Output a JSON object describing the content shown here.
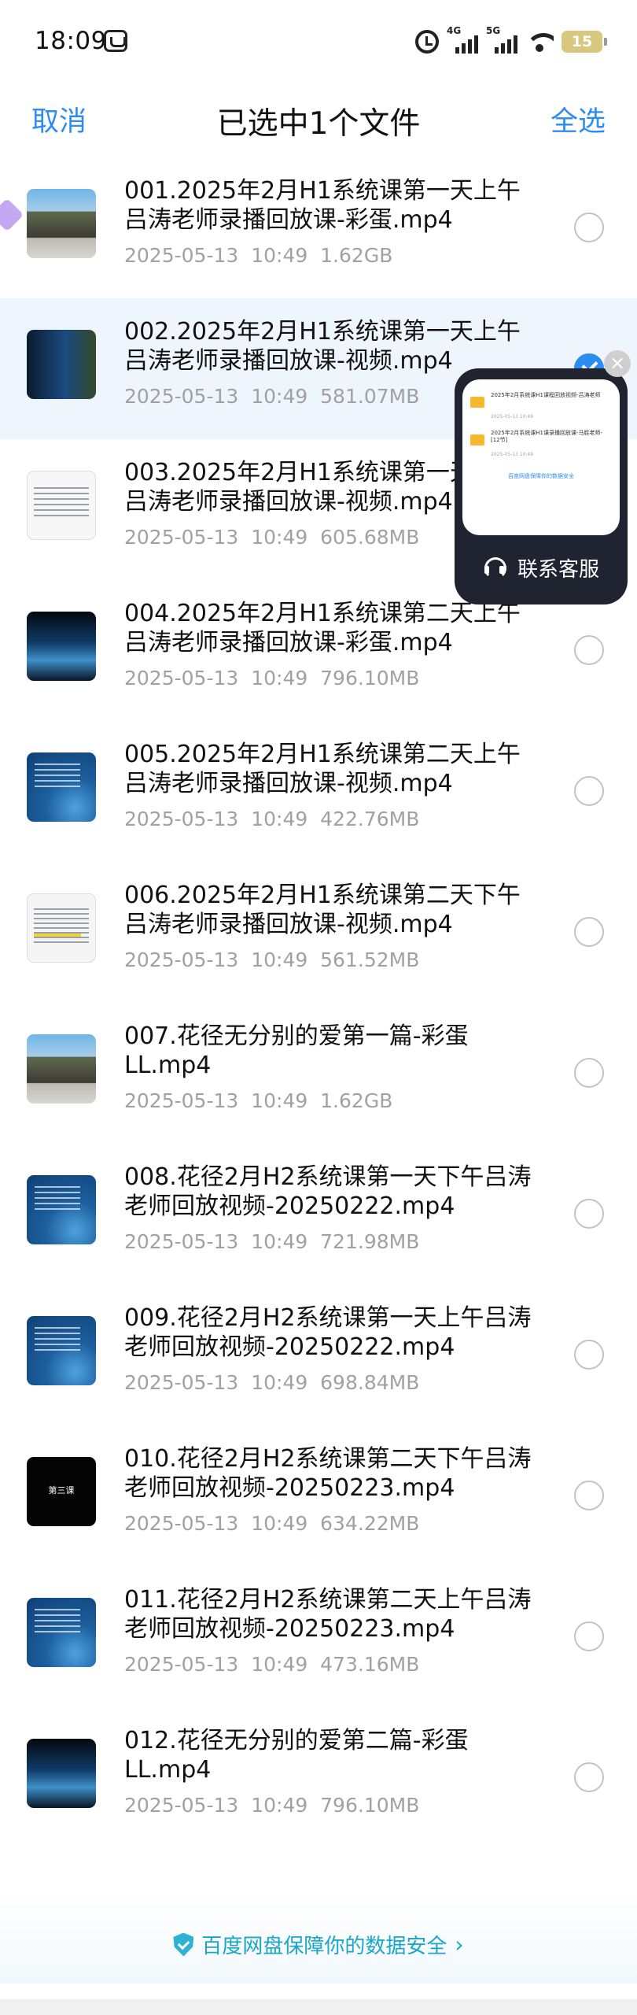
{
  "status_bar": {
    "time": "18:09",
    "network_1": "4G",
    "network_2": "5G",
    "battery": "15"
  },
  "header": {
    "cancel_label": "取消",
    "title": "已选中1个文件",
    "select_all_label": "全选"
  },
  "files": [
    {
      "name": "001.2025年2月H1系统课第一天上午吕涛老师录播回放课-彩蛋.mp4",
      "date": "2025-05-13",
      "time": "10:49",
      "size": "1.62GB",
      "thumb": "photo",
      "selected": false
    },
    {
      "name": "002.2025年2月H1系统课第一天上午吕涛老师录播回放课-视频.mp4",
      "date": "2025-05-13",
      "time": "10:49",
      "size": "581.07MB",
      "thumb": "dark",
      "selected": true
    },
    {
      "name": "003.2025年2月H1系统课第一天下午吕涛老师录播回放课-视频.mp4",
      "date": "2025-05-13",
      "time": "10:49",
      "size": "605.68MB",
      "thumb": "doc",
      "selected": false
    },
    {
      "name": "004.2025年2月H1系统课第二天上午吕涛老师录播回放课-彩蛋.mp4",
      "date": "2025-05-13",
      "time": "10:49",
      "size": "796.10MB",
      "thumb": "mountain",
      "selected": false
    },
    {
      "name": "005.2025年2月H1系统课第二天上午吕涛老师录播回放课-视频.mp4",
      "date": "2025-05-13",
      "time": "10:49",
      "size": "422.76MB",
      "thumb": "blue",
      "selected": false
    },
    {
      "name": "006.2025年2月H1系统课第二天下午吕涛老师录播回放课-视频.mp4",
      "date": "2025-05-13",
      "time": "10:49",
      "size": "561.52MB",
      "thumb": "doc-yellow",
      "selected": false
    },
    {
      "name": "007.花径无分别的爱第一篇-彩蛋LL.mp4",
      "date": "2025-05-13",
      "time": "10:49",
      "size": "1.62GB",
      "thumb": "photo",
      "selected": false
    },
    {
      "name": "008.花径2月H2系统课第一天下午吕涛老师回放视频-20250222.mp4",
      "date": "2025-05-13",
      "time": "10:49",
      "size": "721.98MB",
      "thumb": "blue",
      "selected": false
    },
    {
      "name": "009.花径2月H2系统课第一天上午吕涛老师回放视频-20250222.mp4",
      "date": "2025-05-13",
      "time": "10:49",
      "size": "698.84MB",
      "thumb": "blue",
      "selected": false
    },
    {
      "name": "010.花径2月H2系统课第二天下午吕涛老师回放视频-20250223.mp4",
      "date": "2025-05-13",
      "time": "10:49",
      "size": "634.22MB",
      "thumb": "black",
      "selected": false
    },
    {
      "name": "011.花径2月H2系统课第二天上午吕涛老师回放视频-20250223.mp4",
      "date": "2025-05-13",
      "time": "10:49",
      "size": "473.16MB",
      "thumb": "blue",
      "selected": false
    },
    {
      "name": "012.花径无分别的爱第二篇-彩蛋LL.mp4",
      "date": "2025-05-13",
      "time": "10:49",
      "size": "796.10MB",
      "thumb": "mountain",
      "selected": false
    }
  ],
  "thumb_captions": {
    "black": "第三课"
  },
  "customer_service": {
    "label": "联系客服",
    "preview_items": [
      {
        "title": "2025年2月系统课H1课程回放视频-吕涛老师",
        "sub": "2025-05-13 10:49"
      },
      {
        "title": "2025年2月系统课H1课录播回放课-马胜老师-[12节]",
        "sub": "2025-05-13 10:49"
      }
    ],
    "preview_secure": "百度网盘保障你的数据安全"
  },
  "footer": {
    "security_link": "百度网盘保障你的数据安全"
  }
}
